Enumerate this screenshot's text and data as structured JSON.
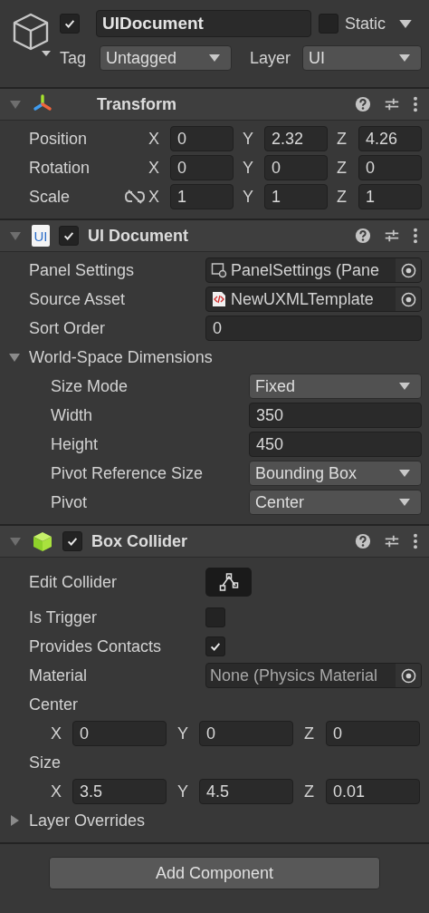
{
  "header": {
    "active": true,
    "name": "UIDocument",
    "static": false,
    "static_label": "Static",
    "tag_label": "Tag",
    "tag": "Untagged",
    "layer_label": "Layer",
    "layer": "UI"
  },
  "components": [
    {
      "kind": "transform",
      "title": "Transform",
      "expanded": true,
      "rows": [
        {
          "kind": "vector3",
          "label": "Position",
          "fields": [
            {
              "axis": "X",
              "value": "0"
            },
            {
              "axis": "Y",
              "value": "2.32"
            },
            {
              "axis": "Z",
              "value": "4.26"
            }
          ]
        },
        {
          "kind": "vector3",
          "label": "Rotation",
          "fields": [
            {
              "axis": "X",
              "value": "0"
            },
            {
              "axis": "Y",
              "value": "0"
            },
            {
              "axis": "Z",
              "value": "0"
            }
          ]
        },
        {
          "kind": "vector3",
          "label": "Scale",
          "constrained": false,
          "fields": [
            {
              "axis": "X",
              "value": "1"
            },
            {
              "axis": "Y",
              "value": "1"
            },
            {
              "axis": "Z",
              "value": "1"
            }
          ]
        }
      ]
    },
    {
      "kind": "ui_document",
      "title": "UI Document",
      "icon_text": "UI",
      "enabled": true,
      "expanded": true,
      "rows": [
        {
          "kind": "settings_object",
          "label": "Panel Settings",
          "value": "PanelSettings (Pane"
        },
        {
          "kind": "template_object",
          "label": "Source Asset",
          "value": "NewUXMLTemplate"
        },
        {
          "kind": "field",
          "label": "Sort Order",
          "value": "0"
        },
        {
          "kind": "foldout",
          "label": "World-Space Dimensions",
          "expanded": true,
          "children": [
            {
              "kind": "dropdown",
              "label": "Size Mode",
              "value": "Fixed"
            },
            {
              "kind": "field",
              "label": "Width",
              "value": "350"
            },
            {
              "kind": "field",
              "label": "Height",
              "value": "450"
            },
            {
              "kind": "dropdown",
              "label": "Pivot Reference Size",
              "value": "Bounding Box"
            },
            {
              "kind": "dropdown",
              "label": "Pivot",
              "value": "Center"
            }
          ]
        }
      ]
    },
    {
      "kind": "box_collider",
      "title": "Box Collider",
      "enabled": true,
      "expanded": true,
      "rows": [
        {
          "kind": "edit",
          "label": "Edit Collider"
        },
        {
          "kind": "toggle",
          "label": "Is Trigger",
          "checked": false
        },
        {
          "kind": "toggle",
          "label": "Provides Contacts",
          "checked": true
        },
        {
          "kind": "empty_object",
          "label": "Material",
          "value": "None (Physics Material"
        },
        {
          "kind": "vector3_below",
          "label": "Center",
          "fields": [
            {
              "axis": "X",
              "value": "0"
            },
            {
              "axis": "Y",
              "value": "0"
            },
            {
              "axis": "Z",
              "value": "0"
            }
          ]
        },
        {
          "kind": "vector3_below",
          "label": "Size",
          "fields": [
            {
              "axis": "X",
              "value": "3.5"
            },
            {
              "axis": "Y",
              "value": "4.5"
            },
            {
              "axis": "Z",
              "value": "0.01"
            }
          ]
        },
        {
          "kind": "foldout",
          "label": "Layer Overrides",
          "expanded": false,
          "children": []
        }
      ]
    }
  ],
  "add_component": "Add Component"
}
